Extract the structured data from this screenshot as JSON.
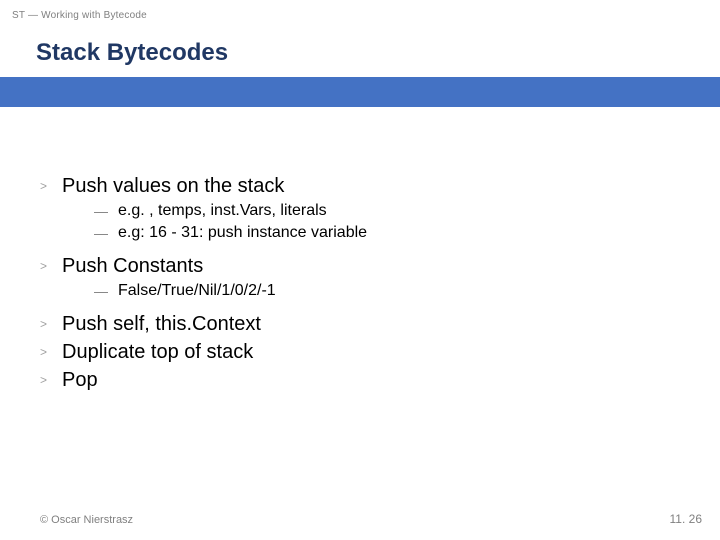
{
  "header": {
    "breadcrumb": "ST — Working with Bytecode",
    "title": "Stack Bytecodes"
  },
  "items": [
    {
      "text": "Push values on the stack",
      "subs": [
        "e.g. , temps, inst.Vars, literals",
        "e.g: 16 - 31: push instance variable"
      ]
    },
    {
      "text": "Push Constants",
      "subs": [
        "False/True/Nil/1/0/2/-1"
      ]
    },
    {
      "text": "Push self, this.Context",
      "subs": []
    },
    {
      "text": "Duplicate top of stack",
      "subs": []
    },
    {
      "text": "Pop",
      "subs": []
    }
  ],
  "footer": {
    "copyright": "© Oscar Nierstrasz",
    "page": "11. 26"
  },
  "symbols": {
    "gt": ">",
    "dash": "—"
  }
}
